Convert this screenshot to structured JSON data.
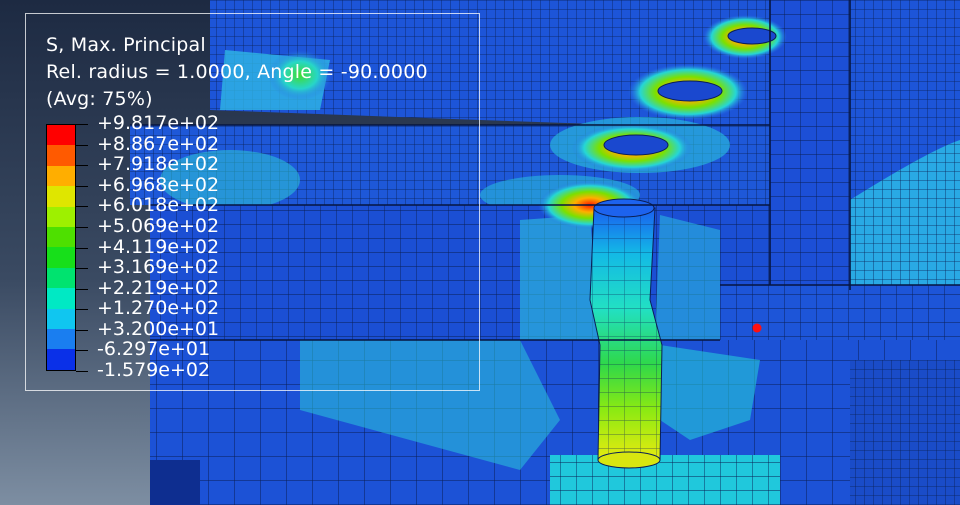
{
  "legend": {
    "title": "S, Max. Principal",
    "subtitle": "Rel. radius = 1.0000, Angle = -90.0000",
    "averaging": "(Avg: 75%)",
    "values": [
      "+9.817e+02",
      "+8.867e+02",
      "+7.918e+02",
      "+6.968e+02",
      "+6.018e+02",
      "+5.069e+02",
      "+4.119e+02",
      "+3.169e+02",
      "+2.219e+02",
      "+1.270e+02",
      "+3.200e+01",
      "-6.297e+01",
      "-1.579e+02"
    ],
    "colors": [
      "#ff0000",
      "#ff5a00",
      "#ffae00",
      "#dfe600",
      "#9ef000",
      "#4ee000",
      "#17df1a",
      "#00e36f",
      "#00e9c4",
      "#10c6f0",
      "#1a7ef0",
      "#0a30e8"
    ]
  },
  "scene": {
    "background_top": "#1d2a42",
    "background_bottom": "#7d8ea2",
    "mesh_blue": "#1a4fd6",
    "cyan": "#35d6e6",
    "green": "#3fdc33",
    "yellow": "#dff000",
    "red": "#ff2000",
    "marker": "#ff1010"
  }
}
